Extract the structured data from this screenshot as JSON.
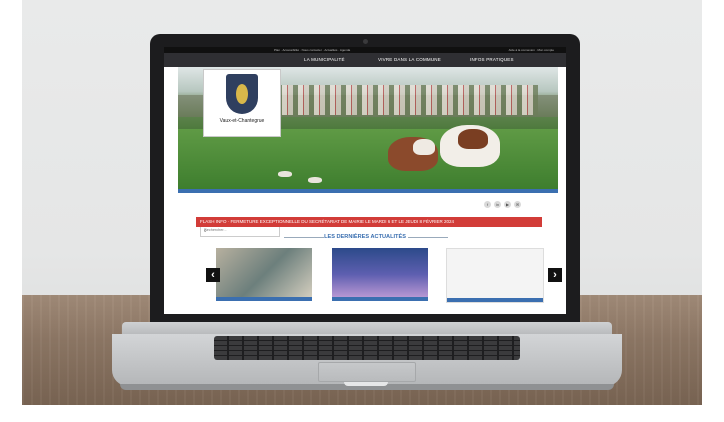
{
  "site": {
    "top_links": "Plan · Accessibilité · Nous contacter · Actualités · Agenda",
    "top_right": "Aide à la connexion · Mon compte",
    "nav": [
      "LA MUNICIPALITÉ",
      "VIVRE DANS LA COMMUNE",
      "INFOS PRATIQUES"
    ],
    "logo_text": "Vaux-et-Chantegrue",
    "search_placeholder": "Rechercher...",
    "flash_label": "FLASH INFO",
    "flash_text": "FERMETURE EXCEPTIONNELLE DU SECRÉTARIAT DE MAIRIE LE MARDI 6 ET LE JEUDI 8 FÉVRIER 2024",
    "news_heading": "LES DERNIÈRES ACTUALITÉS",
    "arrow_left": "‹",
    "arrow_right": "›",
    "social": [
      "f",
      "in",
      "▶",
      "✉"
    ]
  },
  "colors": {
    "nav_bg": "#2f2f33",
    "flash_bg": "#d23c38",
    "accent_blue": "#3b6fb0"
  }
}
